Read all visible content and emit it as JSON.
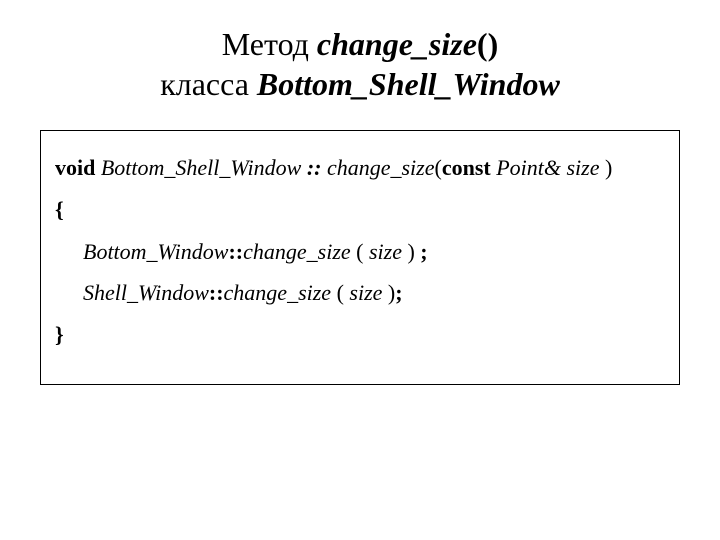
{
  "title": {
    "word_method": "Метод ",
    "method_name": "change_size",
    "parens": "()",
    "word_class": "класса ",
    "class_name": "Bottom_Shell_Window"
  },
  "code": {
    "l1": {
      "void": "void",
      "sp1": " ",
      "cls": "Bottom_Shell_Window",
      "sp2": " ",
      "dcolon": ":: ",
      "meth": "change_size",
      "lpar": "(",
      "const": "const",
      "sp3": " ",
      "type": "Point& size",
      "rest": " )"
    },
    "l2": "{",
    "l3": {
      "base": "Bottom_Window",
      "dcolon": "::",
      "meth": "change_size",
      "mid_plain": " ( ",
      "arg": "size",
      "tail_plain": " ) ",
      "semi": ";"
    },
    "l4": {
      "base": "Shell_Window",
      "dcolon": "::",
      "meth": "change_size",
      "mid_plain": " ( ",
      "arg": "size",
      "tail_plain": " )",
      "semi": ";"
    },
    "l5": "}"
  }
}
